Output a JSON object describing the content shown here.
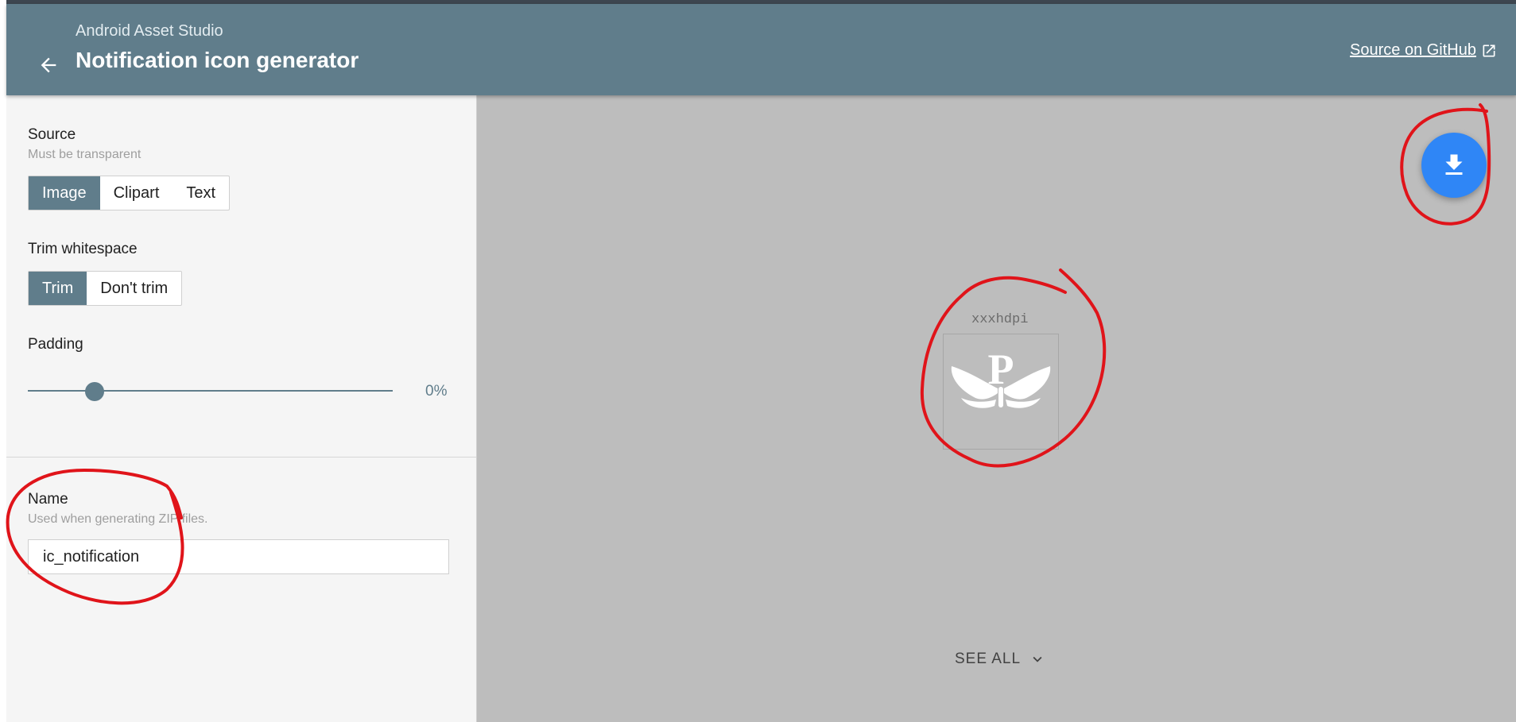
{
  "header": {
    "subtitle": "Android Asset Studio",
    "title": "Notification icon generator",
    "github_link": "Source on GitHub",
    "back_icon": "arrow-left-icon",
    "external_icon": "external-link-icon"
  },
  "sidebar": {
    "source": {
      "label": "Source",
      "help": "Must be transparent",
      "options": [
        "Image",
        "Clipart",
        "Text"
      ],
      "selected": "Image"
    },
    "trim": {
      "label": "Trim whitespace",
      "options": [
        "Trim",
        "Don't trim"
      ],
      "selected": "Trim"
    },
    "padding": {
      "label": "Padding",
      "value": 0,
      "value_text": "0%"
    },
    "name": {
      "label": "Name",
      "help": "Used when generating ZIP files.",
      "value": "ic_notification"
    }
  },
  "preview": {
    "density_label": "xxxhdpi",
    "icon_letter": "P",
    "see_all": "SEE ALL",
    "see_all_icon": "chevron-down-icon",
    "download_icon": "download-icon"
  },
  "colors": {
    "app_bar": "#607d8b",
    "fab": "#2f86f6",
    "annotation": "#e0141a",
    "preview_bg": "#bdbdbd"
  }
}
